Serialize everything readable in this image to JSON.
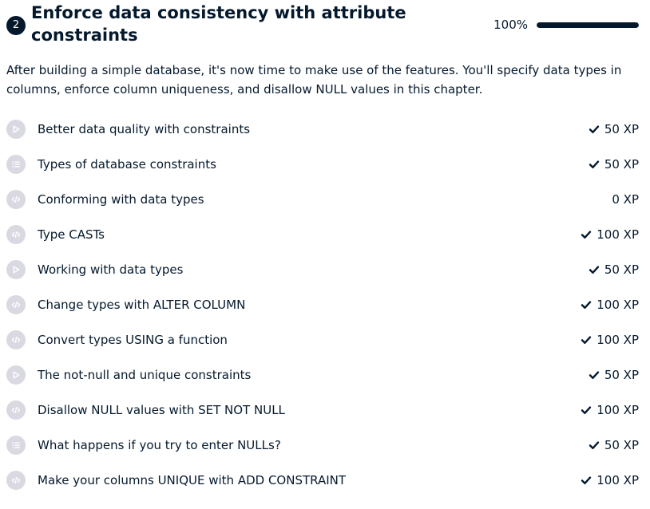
{
  "chapter": {
    "number": "2",
    "title": "Enforce data consistency with attribute constraints",
    "progress_label": "100%",
    "progress_value": 1.0,
    "description": "After building a simple database, it's now time to make use of the features. You'll specify data types in columns, enforce column uniqueness, and disallow NULL values in this chapter."
  },
  "lessons": [
    {
      "title": "Better data quality with constraints",
      "type": "video-icon",
      "xp": "50 XP",
      "completed": true
    },
    {
      "title": "Types of database constraints",
      "type": "list-icon",
      "xp": "50 XP",
      "completed": true
    },
    {
      "title": "Conforming with data types",
      "type": "code-icon",
      "xp": "0 XP",
      "completed": false
    },
    {
      "title": "Type CASTs",
      "type": "code-icon",
      "xp": "100 XP",
      "completed": true
    },
    {
      "title": "Working with data types",
      "type": "video-icon",
      "xp": "50 XP",
      "completed": true
    },
    {
      "title": "Change types with ALTER COLUMN",
      "type": "code-icon",
      "xp": "100 XP",
      "completed": true
    },
    {
      "title": "Convert types USING a function",
      "type": "code-icon",
      "xp": "100 XP",
      "completed": true
    },
    {
      "title": "The not-null and unique constraints",
      "type": "video-icon",
      "xp": "50 XP",
      "completed": true
    },
    {
      "title": "Disallow NULL values with SET NOT NULL",
      "type": "code-icon",
      "xp": "100 XP",
      "completed": true
    },
    {
      "title": "What happens if you try to enter NULLs?",
      "type": "list-icon",
      "xp": "50 XP",
      "completed": true
    },
    {
      "title": "Make your columns UNIQUE with ADD CONSTRAINT",
      "type": "code-icon",
      "xp": "100 XP",
      "completed": true
    }
  ],
  "colors": {
    "text": "#05192d",
    "icon_bg": "#d9d9e2",
    "icon_fg": "#ffffff",
    "progress_track": "#e8e8ea"
  }
}
